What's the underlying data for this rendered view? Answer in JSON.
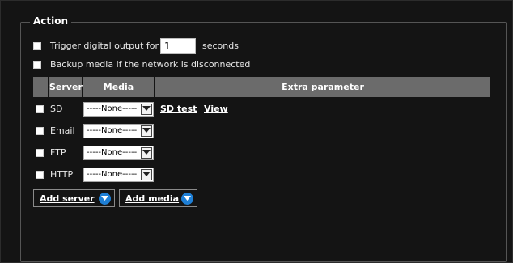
{
  "section": {
    "legend": "Action"
  },
  "trigger": {
    "label": "Trigger digital output for",
    "value": "1",
    "unit": "seconds"
  },
  "backup": {
    "label": "Backup media if the network is disconnected"
  },
  "table": {
    "headers": {
      "server": "Server",
      "media": "Media",
      "extra": "Extra parameter"
    },
    "rows": [
      {
        "server": "SD",
        "media": "-----None-----",
        "links": [
          "SD test",
          "View"
        ]
      },
      {
        "server": "Email",
        "media": "-----None-----"
      },
      {
        "server": "FTP",
        "media": "-----None-----"
      },
      {
        "server": "HTTP",
        "media": "-----None-----"
      }
    ]
  },
  "buttons": {
    "add_server": "Add server",
    "add_media": "Add media"
  },
  "colors": {
    "accent": "#1e7fd6",
    "panel_bg": "#141414",
    "header_bg": "#6b6b6b"
  }
}
